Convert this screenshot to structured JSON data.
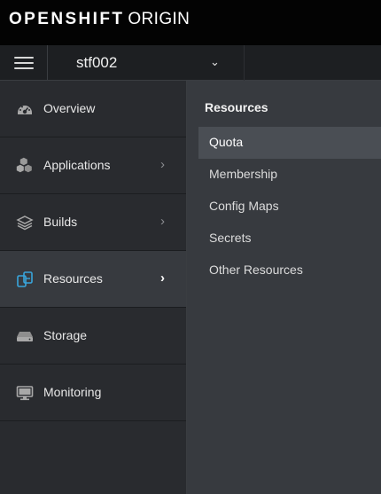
{
  "brand": {
    "bold": "OPENSHIFT",
    "light": "ORIGIN"
  },
  "project": {
    "name": "stf002",
    "caret": "⌄"
  },
  "sidebar": {
    "items": [
      {
        "label": "Overview",
        "icon": "dashboard-icon",
        "chevron": "",
        "active": false
      },
      {
        "label": "Applications",
        "icon": "cubes-icon",
        "chevron": "›",
        "active": false
      },
      {
        "label": "Builds",
        "icon": "layers-icon",
        "chevron": "›",
        "active": false
      },
      {
        "label": "Resources",
        "icon": "resources-icon",
        "chevron": "›",
        "active": true
      },
      {
        "label": "Storage",
        "icon": "storage-icon",
        "chevron": "",
        "active": false
      },
      {
        "label": "Monitoring",
        "icon": "monitor-icon",
        "chevron": "",
        "active": false
      }
    ]
  },
  "secondary": {
    "title": "Resources",
    "items": [
      {
        "label": "Quota",
        "active": true
      },
      {
        "label": "Membership",
        "active": false
      },
      {
        "label": "Config Maps",
        "active": false
      },
      {
        "label": "Secrets",
        "active": false
      },
      {
        "label": "Other Resources",
        "active": false
      }
    ]
  },
  "colors": {
    "accent": "#39a5dc",
    "topbar": "#030303",
    "sidebar": "#292b2f",
    "secondary": "#373a3f"
  }
}
